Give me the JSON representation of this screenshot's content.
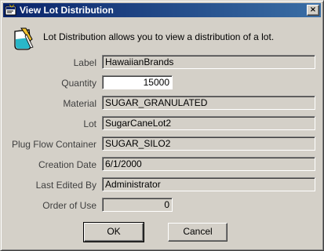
{
  "window": {
    "title": "View Lot Distribution",
    "close_glyph": "×"
  },
  "intro_text": "Lot Distribution allows you to view a distribution of a lot.",
  "icons": {
    "title_icon": "app-icon",
    "info_icon": "beaker-icon"
  },
  "fields": {
    "label": {
      "caption": "Label",
      "value": "HawaiianBrands"
    },
    "quantity": {
      "caption": "Quantity",
      "value": "15000"
    },
    "material": {
      "caption": "Material",
      "value": "SUGAR_GRANULATED"
    },
    "lot": {
      "caption": "Lot",
      "value": "SugarCaneLot2"
    },
    "container": {
      "caption": "Plug Flow Container",
      "value": "SUGAR_SILO2"
    },
    "creation_date": {
      "caption": "Creation Date",
      "value": "6/1/2000"
    },
    "last_edited_by": {
      "caption": "Last Edited By",
      "value": "Administrator"
    },
    "order_of_use": {
      "caption": "Order of Use",
      "value": "0"
    }
  },
  "buttons": {
    "ok": "OK",
    "cancel": "Cancel"
  },
  "colors": {
    "title_bar_start": "#0a246a",
    "title_bar_end": "#3a6ea5",
    "face": "#d4d0c8"
  }
}
